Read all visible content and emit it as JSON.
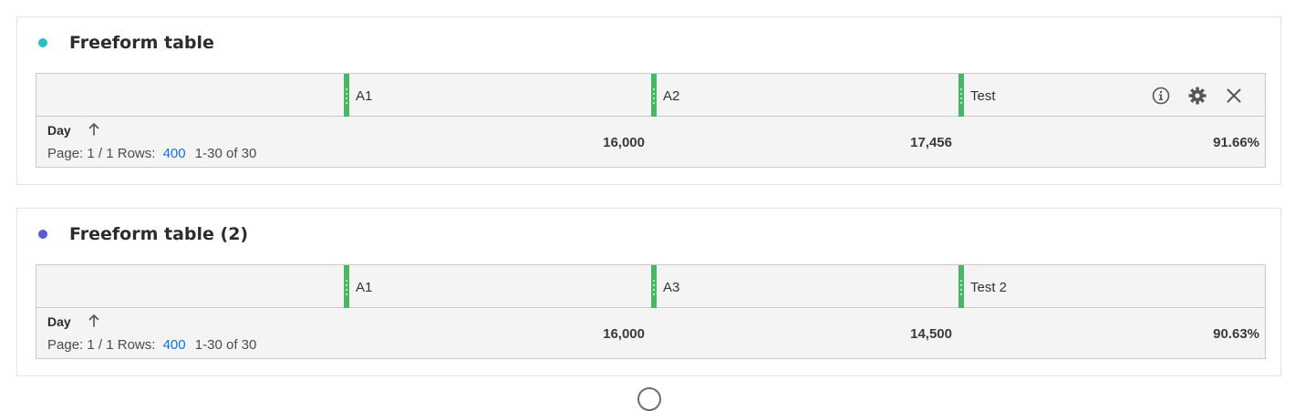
{
  "panels": [
    {
      "title": "Freeform table",
      "dot_color": "#2bbcc6",
      "columns": [
        {
          "label": "A1"
        },
        {
          "label": "A2"
        },
        {
          "label": "Test"
        }
      ],
      "row_header": {
        "dimension": "Day",
        "page_label": "Page: 1 / 1",
        "rows_label": "Rows:",
        "rows_value": "400",
        "range_label": "1-30 of 30"
      },
      "totals": [
        "16,000",
        "17,456",
        "91.66%"
      ],
      "toolbar": [
        "info-icon",
        "gear-icon",
        "close-icon"
      ]
    },
    {
      "title": "Freeform table (2)",
      "dot_color": "#5b5bd6",
      "columns": [
        {
          "label": "A1"
        },
        {
          "label": "A3"
        },
        {
          "label": "Test 2"
        }
      ],
      "row_header": {
        "dimension": "Day",
        "page_label": "Page: 1 / 1",
        "rows_label": "Rows:",
        "rows_value": "400",
        "range_label": "1-30 of 30"
      },
      "totals": [
        "16,000",
        "14,500",
        "90.63%"
      ]
    }
  ],
  "colors": {
    "accent_green": "#47b862",
    "link_blue": "#1473e6"
  }
}
